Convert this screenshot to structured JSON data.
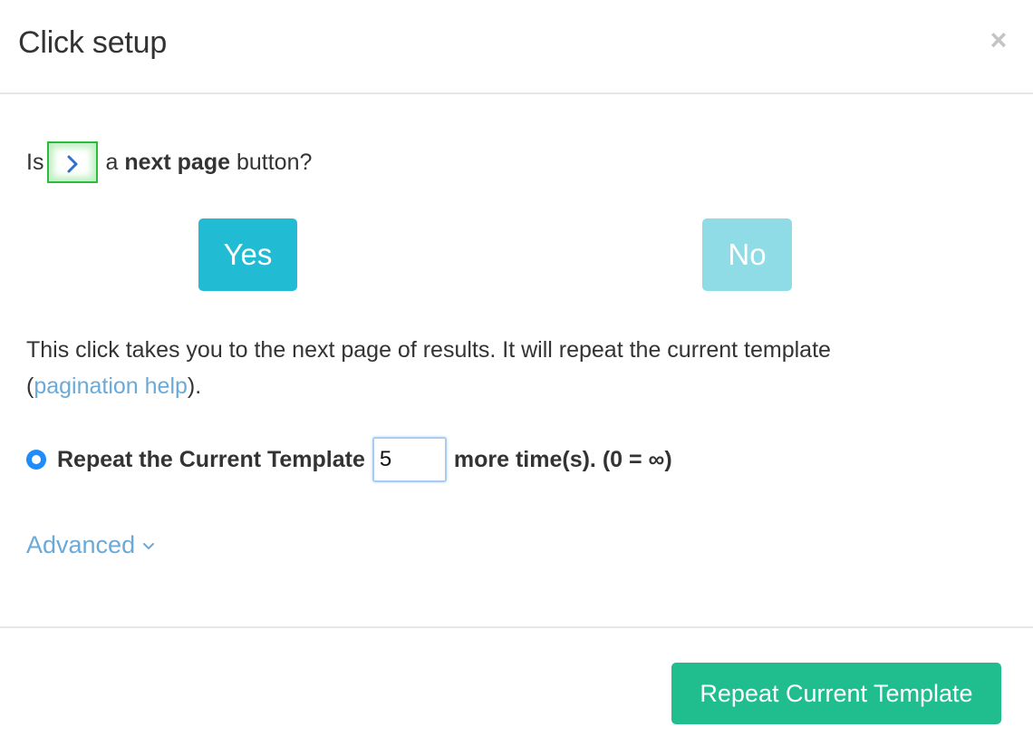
{
  "header": {
    "title": "Click setup",
    "close_icon": "×"
  },
  "question": {
    "prefix": "Is",
    "mid": "a",
    "bold": "next page",
    "suffix": "button?",
    "preview_icon": "chevron-right"
  },
  "choices": {
    "yes_label": "Yes",
    "no_label": "No"
  },
  "description": {
    "text": "This click takes you to the next page of results. It will repeat the current template",
    "open_paren": "(",
    "link_text": "pagination help",
    "close": ")."
  },
  "repeat": {
    "label": "Repeat the Current Template",
    "value": "5",
    "suffix": "more time(s). (0 = ∞)",
    "selected": true
  },
  "advanced": {
    "label": "Advanced"
  },
  "footer": {
    "primary_label": "Repeat Current Template"
  },
  "colors": {
    "yes": "#21bcd3",
    "no": "#8fdce6",
    "primary": "#20bd8e",
    "link": "#6aaad9",
    "radio": "#1f8cf7",
    "preview_border": "#2dbb3e"
  }
}
